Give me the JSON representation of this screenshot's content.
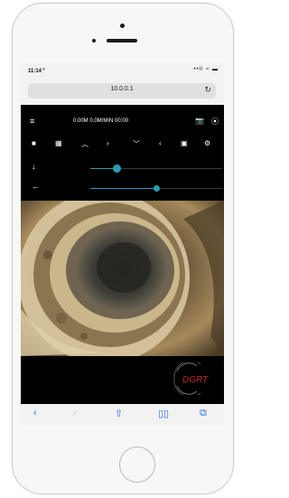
{
  "status_bar": {
    "time": "11:14 ⁠⸢",
    "indicators": "••ll ≈ ▬"
  },
  "browser": {
    "url": "10.0.0.1",
    "reload_icon": "↻"
  },
  "controls": {
    "stats": "0.00M 0.0M/MIN 00:00",
    "row1_icons": [
      "menu-icon",
      "camera-icon",
      "record-icon"
    ],
    "row2_icons": [
      "stop-square-icon",
      "grid-icon",
      "chevron-up-icon",
      "chevron-right-icon",
      "chevron-down-icon",
      "chevron-left-icon",
      "save-icon",
      "settings-icon"
    ],
    "slider1": {
      "level": 0.2
    },
    "slider2": {
      "level": 0.5
    }
  },
  "logo_text": "DGRT",
  "accent_color": "#2a9db1",
  "safari_toolbar": [
    "back-icon",
    "forward-icon",
    "share-icon",
    "bookmarks-icon",
    "tabs-icon"
  ]
}
